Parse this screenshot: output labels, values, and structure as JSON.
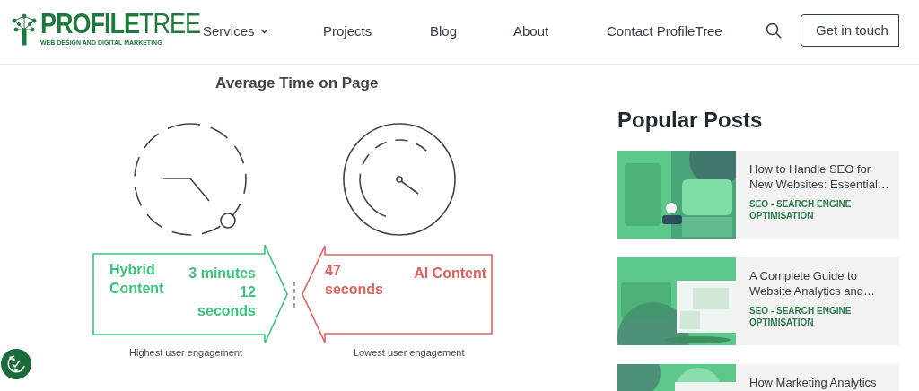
{
  "header": {
    "logo": {
      "main": "PROFILE",
      "accent": "TREE",
      "tagline": "WEB DESIGN AND DIGITAL MARKETING"
    },
    "nav": [
      {
        "label": "Services",
        "dropdown": true
      },
      {
        "label": "Projects",
        "dropdown": false
      },
      {
        "label": "Blog",
        "dropdown": false
      },
      {
        "label": "About",
        "dropdown": false
      },
      {
        "label": "Contact ProfileTree",
        "dropdown": false
      }
    ],
    "button": "Get in touch"
  },
  "infographic": {
    "title": "Average Time on Page",
    "items": [
      {
        "kind": "hybrid",
        "content_type": "Hybrid Content",
        "duration": "3 minutes 12 seconds",
        "caption": "Highest user engagement",
        "color": "#3cc47c"
      },
      {
        "kind": "ai",
        "duration": "47 seconds",
        "content_type": "AI Content",
        "caption": "Lowest user engagement",
        "color": "#e0605a"
      }
    ]
  },
  "sidebar": {
    "heading": "Popular Posts",
    "posts": [
      {
        "title": "How to Handle SEO for New Websites: Essential…",
        "category": "SEO - SEARCH ENGINE OPTIMISATION"
      },
      {
        "title": "A Complete Guide to Website Analytics and…",
        "category": "SEO - SEARCH ENGINE OPTIMISATION"
      },
      {
        "title": "How Marketing Analytics"
      }
    ]
  }
}
